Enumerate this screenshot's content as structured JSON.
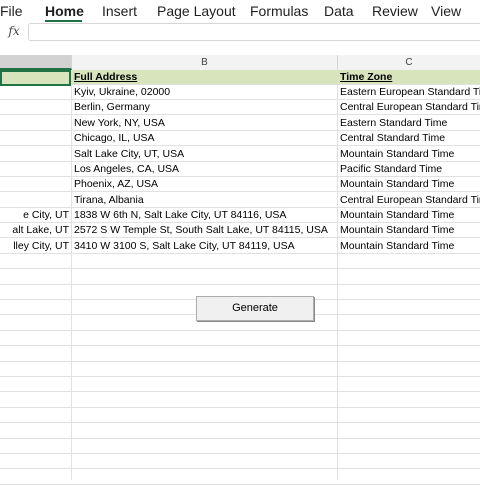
{
  "ribbon": {
    "tabs": [
      {
        "label": "File"
      },
      {
        "label": "Home"
      },
      {
        "label": "Insert"
      },
      {
        "label": "Page Layout"
      },
      {
        "label": "Formulas"
      },
      {
        "label": "Data"
      },
      {
        "label": "Review"
      },
      {
        "label": "View"
      }
    ],
    "active_tab": "Home",
    "accent_color": "#1e7145"
  },
  "formula_bar": {
    "fx_label": "fx",
    "value": ""
  },
  "columns": [
    {
      "label": ""
    },
    {
      "label": "B"
    },
    {
      "label": "C"
    }
  ],
  "sheet": {
    "header": {
      "a": "",
      "b": "Full Address",
      "c": "Time Zone"
    },
    "header_fill": "#d8e4bc",
    "rows": [
      {
        "a": "",
        "b": "Kyiv, Ukraine, 02000",
        "c": "Eastern European Standard Time"
      },
      {
        "a": "",
        "b": "Berlin, Germany",
        "c": "Central European Standard Time"
      },
      {
        "a": "",
        "b": "New York, NY, USA",
        "c": "Eastern Standard Time"
      },
      {
        "a": "",
        "b": "Chicago, IL, USA",
        "c": "Central Standard Time"
      },
      {
        "a": "",
        "b": "Salt Lake City, UT, USA",
        "c": "Mountain Standard Time"
      },
      {
        "a": "",
        "b": "Los Angeles, CA, USA",
        "c": "Pacific Standard Time"
      },
      {
        "a": "",
        "b": "Phoenix, AZ, USA",
        "c": "Mountain Standard Time"
      },
      {
        "a": "",
        "b": "Tirana, Albania",
        "c": "Central European Standard Time"
      },
      {
        "a": "e City, UT",
        "b": "1838 W 6th N, Salt Lake City, UT 84116, USA",
        "c": "Mountain Standard Time"
      },
      {
        "a": "alt Lake, UT",
        "b": "2572 S W Temple St, South Salt Lake, UT 84115, USA",
        "c": "Mountain Standard Time"
      },
      {
        "a": "lley City, UT",
        "b": "3410 W 3100 S, Salt Lake City, UT 84119, USA",
        "c": "Mountain Standard Time"
      }
    ]
  },
  "generate_button": {
    "label": "Generate"
  }
}
